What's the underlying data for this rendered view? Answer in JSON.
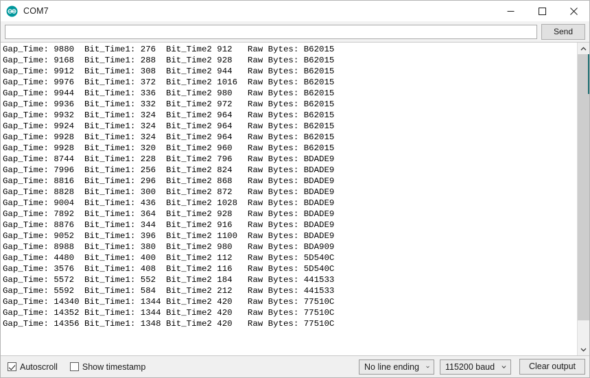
{
  "window": {
    "title": "COM7",
    "app_icon": "arduino-logo-icon",
    "controls": {
      "minimize": "minimize-icon",
      "maximize": "maximize-icon",
      "close": "close-icon"
    }
  },
  "send_bar": {
    "input_value": "",
    "input_placeholder": "",
    "send_label": "Send"
  },
  "console": {
    "columns": [
      "Gap_Time:",
      "Bit_Time1:",
      "Bit_Time2",
      "Raw Bytes:"
    ],
    "lines": [
      {
        "gap_time": "9880",
        "bit_time1": "276",
        "bit_time2": "912",
        "raw_bytes": "B62015"
      },
      {
        "gap_time": "9168",
        "bit_time1": "288",
        "bit_time2": "928",
        "raw_bytes": "B62015"
      },
      {
        "gap_time": "9912",
        "bit_time1": "308",
        "bit_time2": "944",
        "raw_bytes": "B62015"
      },
      {
        "gap_time": "9976",
        "bit_time1": "372",
        "bit_time2": "1016",
        "raw_bytes": "B62015"
      },
      {
        "gap_time": "9944",
        "bit_time1": "336",
        "bit_time2": "980",
        "raw_bytes": "B62015"
      },
      {
        "gap_time": "9936",
        "bit_time1": "332",
        "bit_time2": "972",
        "raw_bytes": "B62015"
      },
      {
        "gap_time": "9932",
        "bit_time1": "324",
        "bit_time2": "964",
        "raw_bytes": "B62015"
      },
      {
        "gap_time": "9924",
        "bit_time1": "324",
        "bit_time2": "964",
        "raw_bytes": "B62015"
      },
      {
        "gap_time": "9928",
        "bit_time1": "324",
        "bit_time2": "964",
        "raw_bytes": "B62015"
      },
      {
        "gap_time": "9928",
        "bit_time1": "320",
        "bit_time2": "960",
        "raw_bytes": "B62015"
      },
      {
        "gap_time": "8744",
        "bit_time1": "228",
        "bit_time2": "796",
        "raw_bytes": "BDADE9"
      },
      {
        "gap_time": "7996",
        "bit_time1": "256",
        "bit_time2": "824",
        "raw_bytes": "BDADE9"
      },
      {
        "gap_time": "8816",
        "bit_time1": "296",
        "bit_time2": "868",
        "raw_bytes": "BDADE9"
      },
      {
        "gap_time": "8828",
        "bit_time1": "300",
        "bit_time2": "872",
        "raw_bytes": "BDADE9"
      },
      {
        "gap_time": "9004",
        "bit_time1": "436",
        "bit_time2": "1028",
        "raw_bytes": "BDADE9"
      },
      {
        "gap_time": "7892",
        "bit_time1": "364",
        "bit_time2": "928",
        "raw_bytes": "BDADE9"
      },
      {
        "gap_time": "8876",
        "bit_time1": "344",
        "bit_time2": "916",
        "raw_bytes": "BDADE9"
      },
      {
        "gap_time": "9052",
        "bit_time1": "396",
        "bit_time2": "1100",
        "raw_bytes": "BDADE9"
      },
      {
        "gap_time": "8988",
        "bit_time1": "380",
        "bit_time2": "980",
        "raw_bytes": "BDA909"
      },
      {
        "gap_time": "4480",
        "bit_time1": "400",
        "bit_time2": "112",
        "raw_bytes": "5D540C"
      },
      {
        "gap_time": "3576",
        "bit_time1": "408",
        "bit_time2": "116",
        "raw_bytes": "5D540C"
      },
      {
        "gap_time": "5572",
        "bit_time1": "552",
        "bit_time2": "184",
        "raw_bytes": "441533"
      },
      {
        "gap_time": "5592",
        "bit_time1": "584",
        "bit_time2": "212",
        "raw_bytes": "441533"
      },
      {
        "gap_time": "14340",
        "bit_time1": "1344",
        "bit_time2": "420",
        "raw_bytes": "77510C"
      },
      {
        "gap_time": "14352",
        "bit_time1": "1344",
        "bit_time2": "420",
        "raw_bytes": "77510C"
      },
      {
        "gap_time": "14356",
        "bit_time1": "1348",
        "bit_time2": "420",
        "raw_bytes": "77510C"
      }
    ]
  },
  "scrollbar": {
    "up_arrow": "chevron-up-icon",
    "down_arrow": "chevron-down-icon",
    "thumb_position_percent": 0,
    "thumb_size_percent": 92
  },
  "status_bar": {
    "autoscroll": {
      "label": "Autoscroll",
      "checked": true
    },
    "show_timestamp": {
      "label": "Show timestamp",
      "checked": false
    },
    "line_ending": {
      "value": "No line ending",
      "chevron": "chevron-down-icon"
    },
    "baud_rate": {
      "value": "115200 baud",
      "chevron": "chevron-down-icon"
    },
    "clear_output_label": "Clear output"
  },
  "colors": {
    "accent": "#00979c",
    "titlebar_bg": "#ffffff",
    "chrome_bg": "#f0f0f0",
    "console_bg": "#ffffff",
    "text": "#000000",
    "scroll_thumb": "#cdcdcd",
    "scroll_edge": "#1f6f73"
  }
}
